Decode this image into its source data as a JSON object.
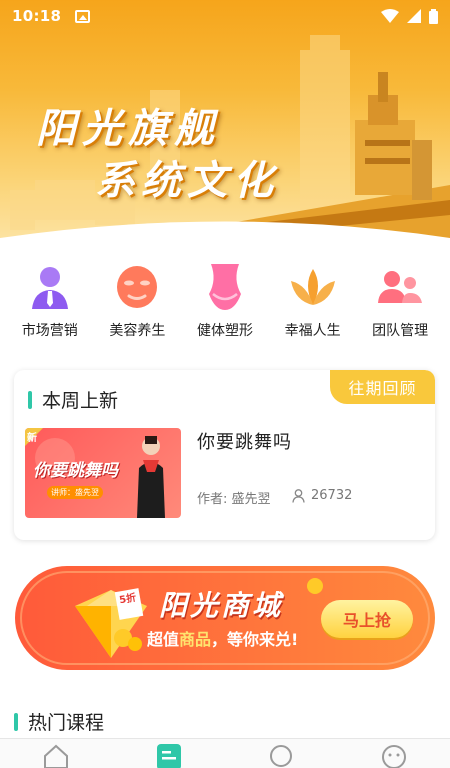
{
  "status_bar": {
    "time": "10:18",
    "icons": [
      "image-icon",
      "wifi-icon",
      "cellular-signal-icon",
      "battery-icon"
    ]
  },
  "hero": {
    "title_line1": "阳光旗舰",
    "title_line2": "系统文化"
  },
  "categories": [
    {
      "label": "市场营销",
      "icon": "person-tie-icon",
      "color": "#8e5bf0"
    },
    {
      "label": "美容养生",
      "icon": "face-mask-icon",
      "color": "#ff7a5c"
    },
    {
      "label": "健体塑形",
      "icon": "body-shape-icon",
      "color": "#ff6fa5"
    },
    {
      "label": "幸福人生",
      "icon": "lotus-icon",
      "color": "#f6a02f"
    },
    {
      "label": "团队管理",
      "icon": "team-icon",
      "color": "#ff6f7f"
    }
  ],
  "weekly": {
    "title": "本周上新",
    "past_label": "往期回顾",
    "course": {
      "thumb_title": "你要跳舞吗",
      "thumb_lecturer": "讲师：盛先翌",
      "thumb_badge": "新",
      "title": "你要跳舞吗",
      "author": "作者: 盛先翌",
      "views": "26732"
    }
  },
  "mall_banner": {
    "title": "阳光商城",
    "slogan_prefix": "超值",
    "slogan_highlight": "商品",
    "slogan_suffix": "，等你来兑!",
    "button": "马上抢",
    "coupon": "5折"
  },
  "hot": {
    "title": "热门课程"
  },
  "bottom_nav": [
    {
      "icon": "home-icon",
      "active": false
    },
    {
      "icon": "course-list-icon",
      "active": true
    },
    {
      "icon": "discover-icon",
      "active": false
    },
    {
      "icon": "profile-icon",
      "active": false
    }
  ],
  "colors": {
    "accent_green": "#2fc7a8",
    "tab_yellow": "#f9c83c",
    "banner_orange": "#ff6b3d"
  }
}
